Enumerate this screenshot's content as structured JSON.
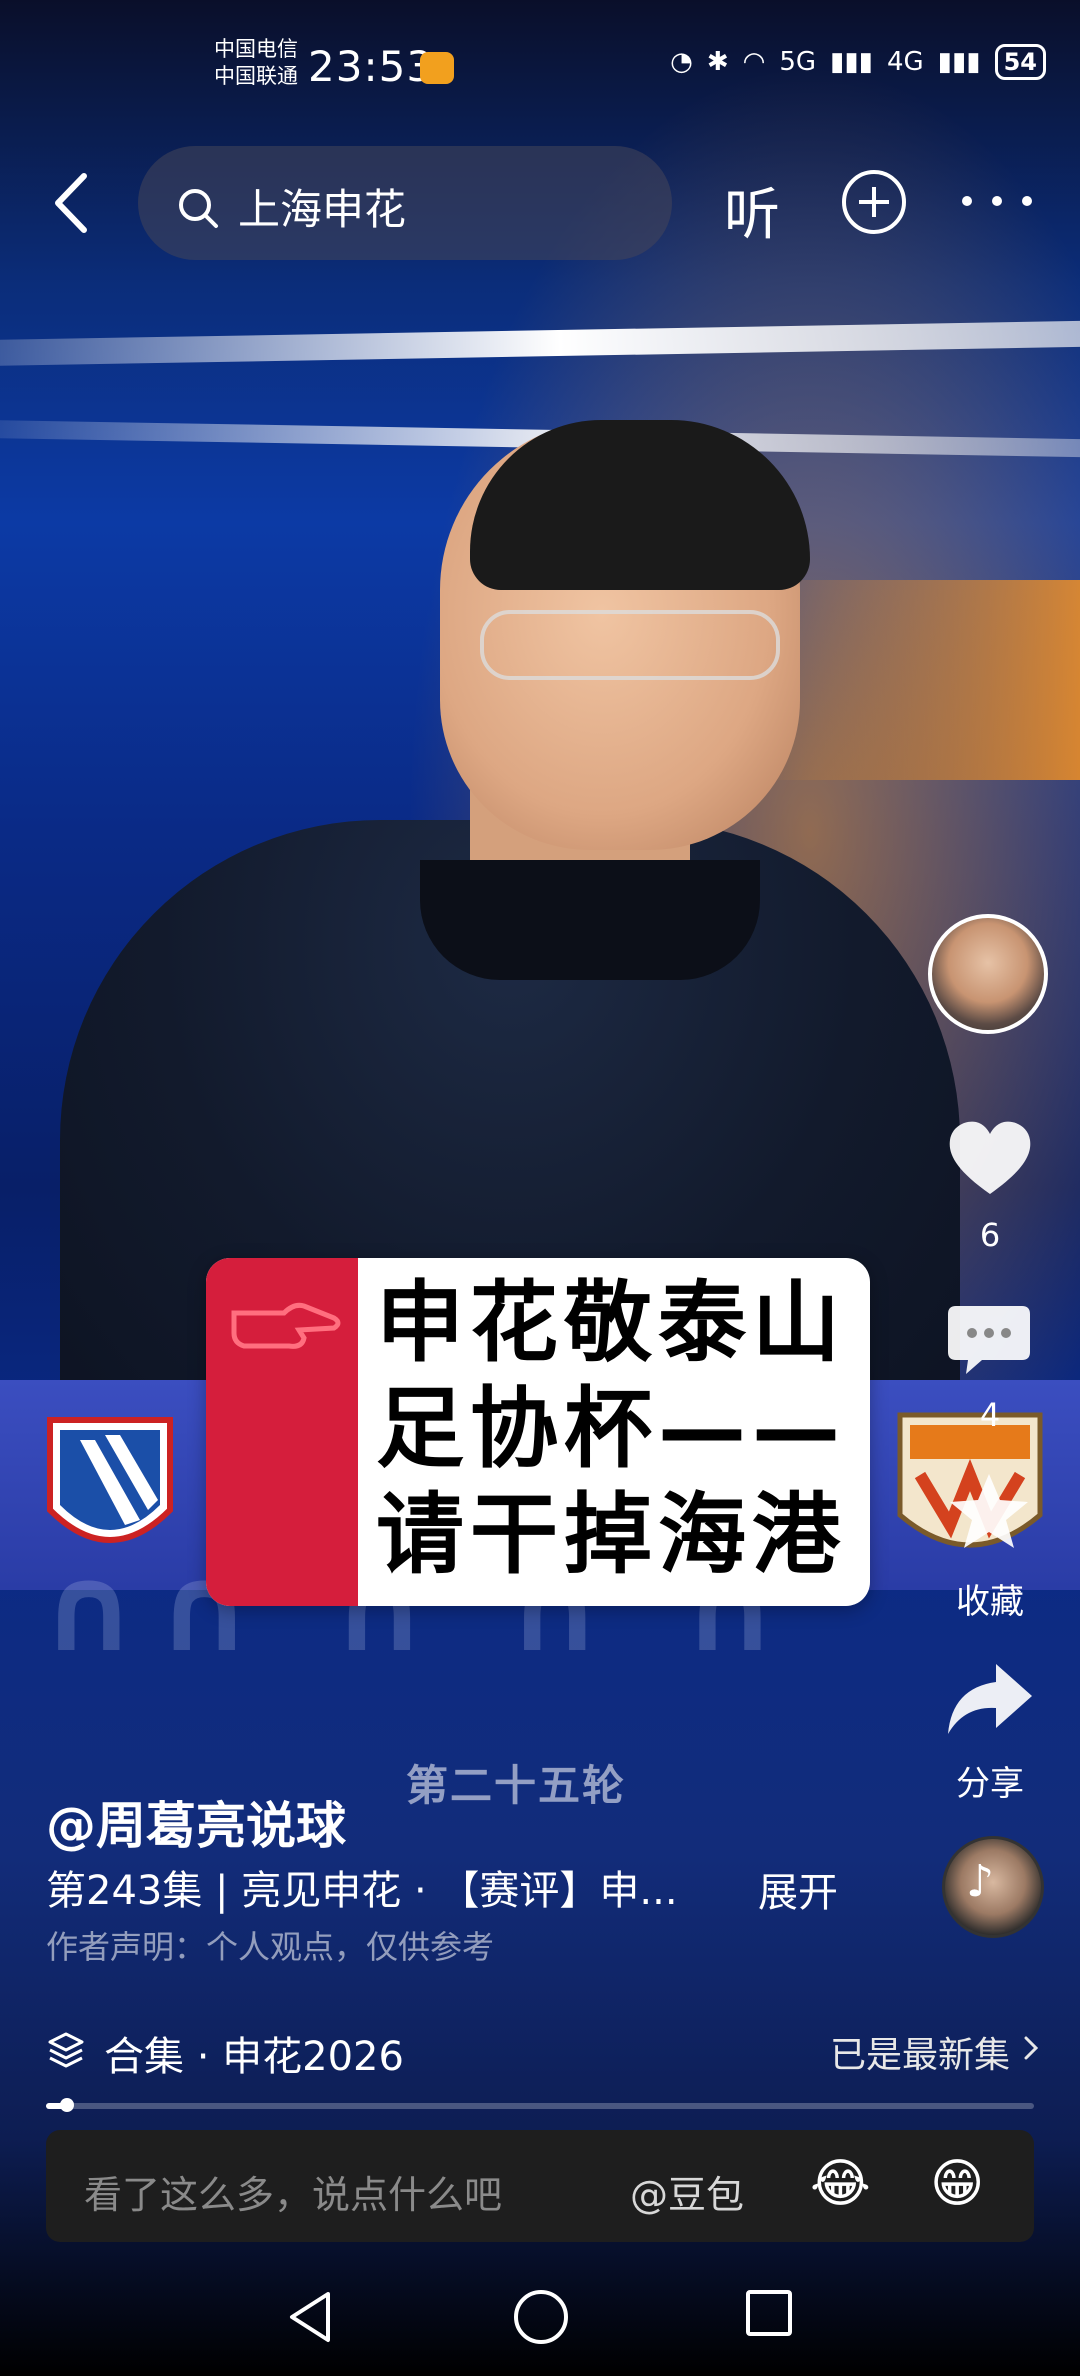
{
  "status_bar": {
    "carrier_1": "中国电信",
    "carrier_2": "中国联通",
    "time": "23:53",
    "network_1": "5G",
    "network_2": "4G",
    "battery": "54"
  },
  "top_bar": {
    "search_text": "上海申花",
    "listen_label": "听"
  },
  "video": {
    "caption_lines": [
      "申花敬泰山",
      "足协杯——",
      "请干掉海港"
    ],
    "round_text": "第二十五轮"
  },
  "actions": {
    "like_count": "6",
    "comment_count": "4",
    "favorite_label": "收藏",
    "share_label": "分享"
  },
  "post": {
    "author": "@周葛亮说球",
    "episode_title": "第243集 | 亮见申花 · 【赛评】申...",
    "expand_label": "展开",
    "disclaimer": "作者声明：个人观点，仅供参考"
  },
  "collection": {
    "label": "合集 · 申花2026",
    "latest_label": "已是最新集",
    "progress": 0.02
  },
  "comment_input": {
    "placeholder": "看了这么多，说点什么吧",
    "mention": "@豆包",
    "emoji_1": "😂",
    "emoji_2": "😁"
  }
}
